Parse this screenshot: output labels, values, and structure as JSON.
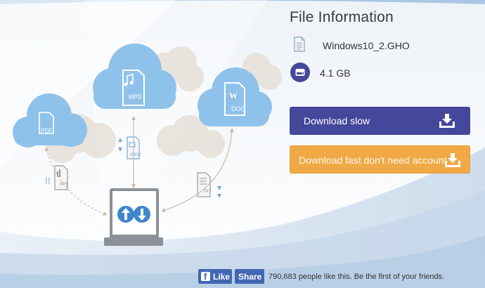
{
  "file_info": {
    "title": "File Information",
    "file_name": "Windows10_2.GHO",
    "file_size": "4.1 GB"
  },
  "buttons": {
    "download_slow": "Download slow",
    "download_fast": "Download fast don't need account"
  },
  "illustration": {
    "cloud_labels": [
      "PDF",
      "MP3",
      "DOC"
    ],
    "floating_labels": [
      "JPEG",
      "PPT",
      "TXT"
    ]
  },
  "facebook": {
    "like_label": "Like",
    "share_label": "Share",
    "social_text": "790,683 people like this. Be the first of your friends."
  },
  "colors": {
    "slow_button": "#44479a",
    "fast_button": "#f0a945",
    "cloud": "#8ec2ea",
    "facebook": "#4267b2"
  }
}
